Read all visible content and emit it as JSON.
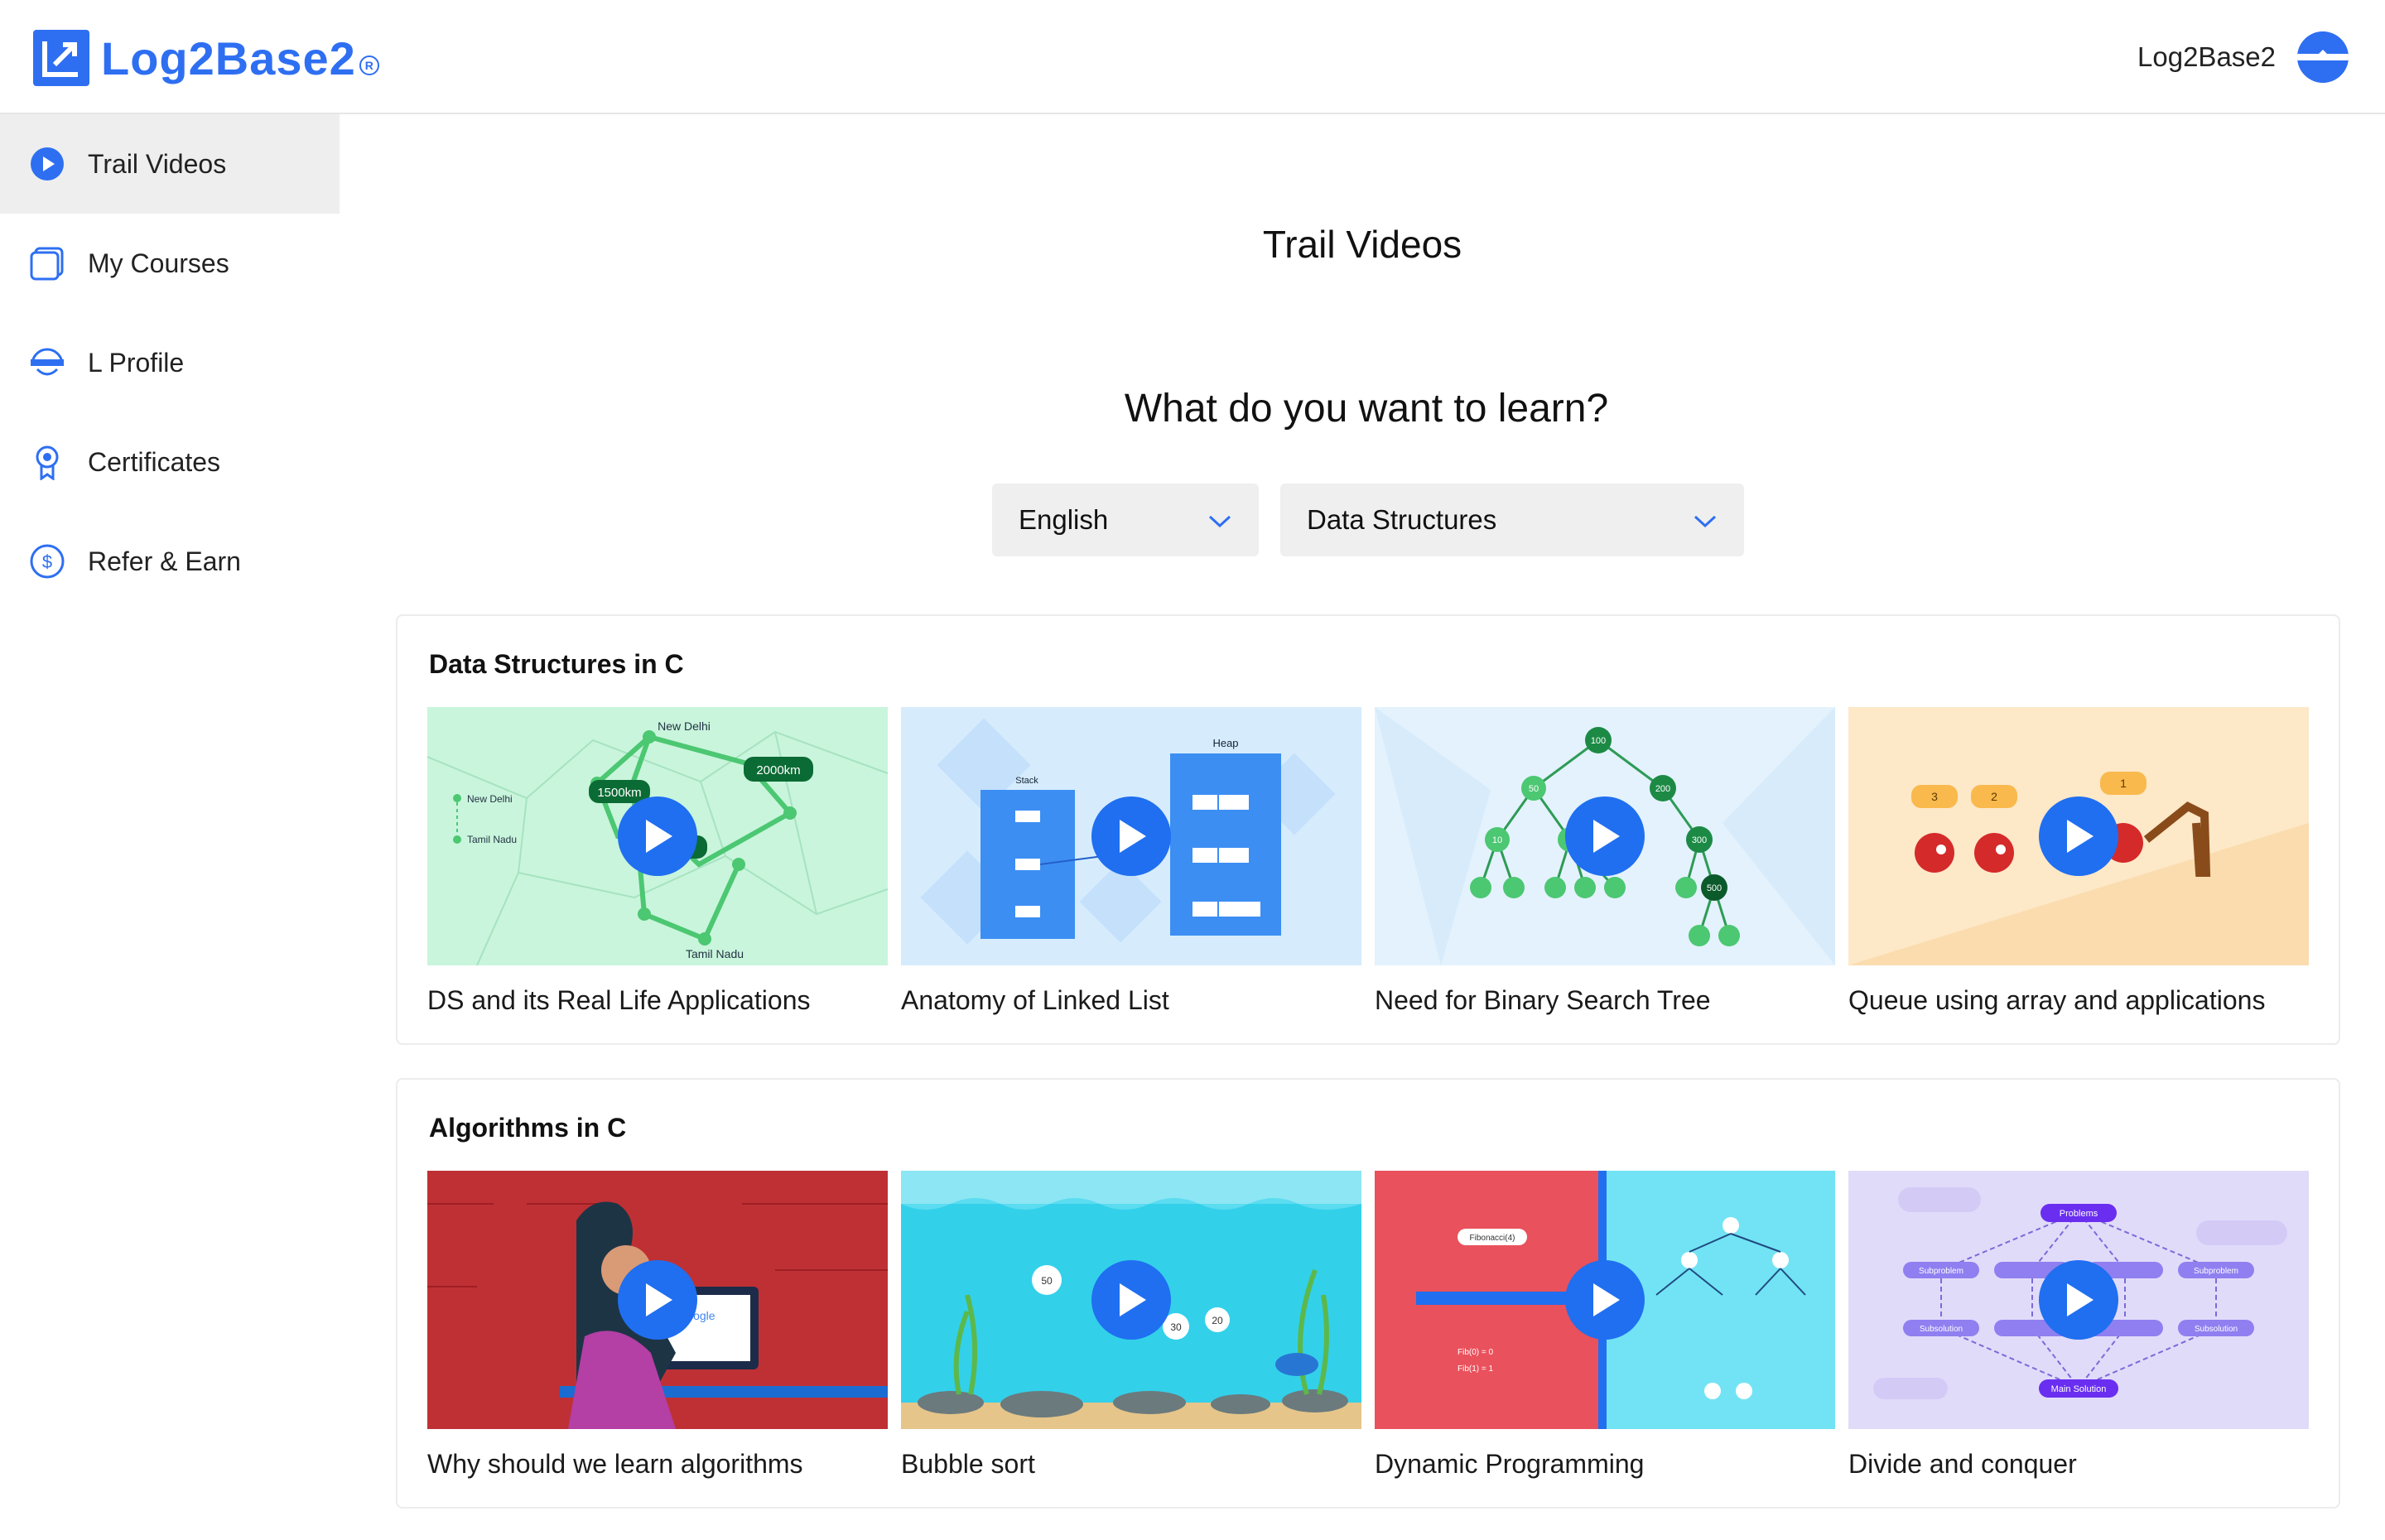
{
  "header": {
    "logo_text": "Log2Base2",
    "logo_reg": "R",
    "user_name": "Log2Base2"
  },
  "sidebar": {
    "items": [
      {
        "label": "Trail Videos",
        "icon": "play-circle-icon",
        "active": true
      },
      {
        "label": "My Courses",
        "icon": "courses-icon"
      },
      {
        "label": "L Profile",
        "icon": "profile-icon"
      },
      {
        "label": "Certificates",
        "icon": "certificate-icon"
      },
      {
        "label": "Refer & Earn",
        "icon": "dollar-icon"
      }
    ]
  },
  "main": {
    "title": "Trail Videos",
    "question": "What do you want to learn?",
    "language_select": "English",
    "topic_select": "Data Structures"
  },
  "sections": [
    {
      "title": "Data Structures in C",
      "cards": [
        {
          "title": "DS and its Real Life Applications",
          "thumb_bg": "#c9f5dc",
          "labels": [
            "New Delhi",
            "1500km",
            "2000km",
            "New Delhi",
            "Tamil Nadu",
            "Tamil Nadu"
          ]
        },
        {
          "title": "Anatomy of Linked List",
          "thumb_bg": "#d6ecfd",
          "labels": [
            "Stack",
            "Heap"
          ]
        },
        {
          "title": "Need for Binary Search Tree",
          "thumb_bg": "#e3f2fd",
          "labels": [
            "100",
            "50",
            "200",
            "10",
            "300",
            "500"
          ]
        },
        {
          "title": "Queue using array and applications",
          "thumb_bg": "#fde8c8",
          "labels": [
            "3",
            "2",
            "1"
          ]
        }
      ]
    },
    {
      "title": "Algorithms in C",
      "cards": [
        {
          "title": "Why should we learn algorithms",
          "thumb_bg": "#c7393c",
          "labels": [
            "Google"
          ]
        },
        {
          "title": "Bubble sort",
          "thumb_bg": "#33d0ea",
          "labels": [
            "50",
            "30",
            "20"
          ]
        },
        {
          "title": "Dynamic Programming",
          "thumb_bg": "#e9515c",
          "labels": [
            "Fibonacci(4)",
            "Fib(0) = 0",
            "Fib(1) = 1"
          ]
        },
        {
          "title": "Divide and conquer",
          "thumb_bg": "#e1dbfa",
          "labels": [
            "Problems",
            "Subproblem",
            "Subsolution",
            "Main Solution"
          ]
        }
      ]
    }
  ],
  "colors": {
    "accent": "#2e6ff2",
    "play": "#1f6ff0",
    "active_nav": "#eeeeee"
  }
}
